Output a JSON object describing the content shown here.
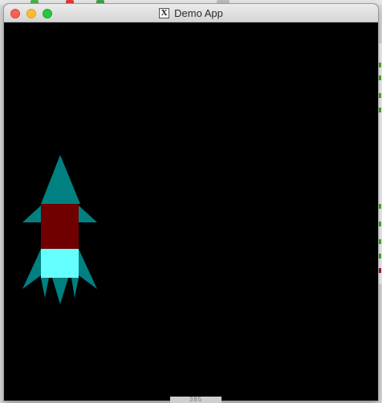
{
  "window": {
    "title": "Demo App",
    "app_icon": "x11-icon",
    "app_icon_glyph": "X"
  },
  "traffic_lights": {
    "close_color": "#fd5f57",
    "minimize_color": "#febc2e",
    "maximize_color": "#28c840"
  },
  "canvas": {
    "background": "#000000",
    "rocket": {
      "nose_color": "#008080",
      "body_color": "#700000",
      "tail_color": "#66ffff",
      "fin_color": "#008080"
    }
  },
  "background": {
    "dock_hint_text": "385"
  }
}
